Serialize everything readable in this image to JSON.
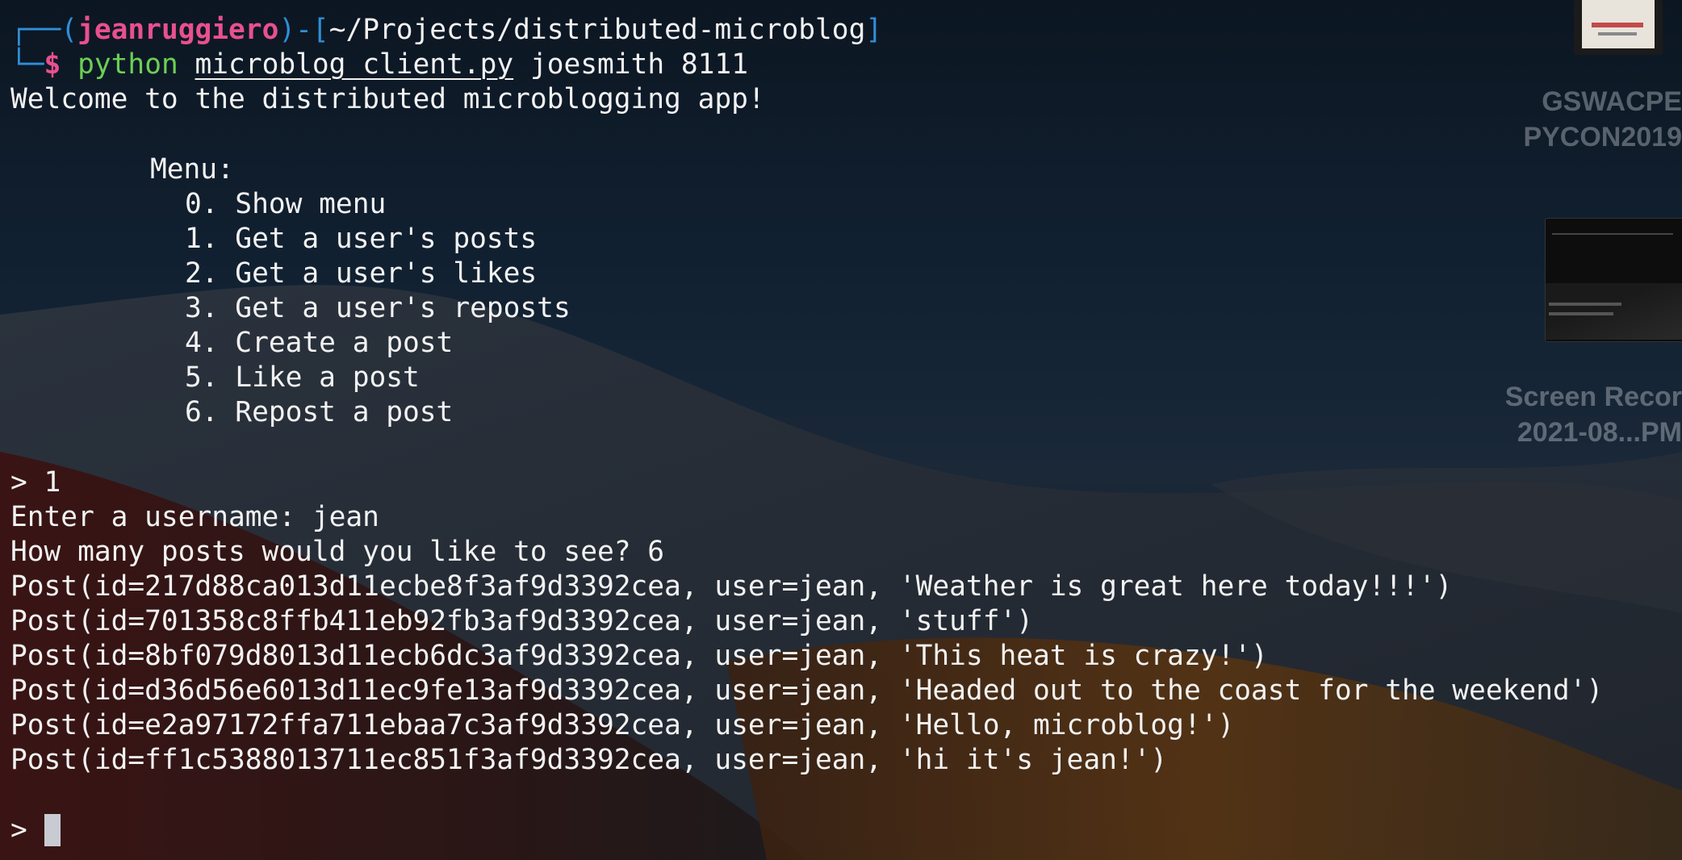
{
  "prompt": {
    "corner_top": "┌──",
    "open_paren": "(",
    "user": "jeanruggiero",
    "close_paren": ")",
    "dash": "-",
    "open_bracket": "[",
    "path": "~/Projects/distributed-microblog",
    "close_bracket": "]",
    "corner_bottom": "└─",
    "dollar": "$",
    "command": "python",
    "script": "microblog_client.py",
    "args": "joesmith 8111"
  },
  "output": {
    "welcome": "Welcome to the distributed microblogging app!",
    "menu_title": "Menu:",
    "menu_items": [
      "0. Show menu",
      "1. Get a user's posts",
      "2. Get a user's likes",
      "3. Get a user's reposts",
      "4. Create a post",
      "5. Like a post",
      "6. Repost a post"
    ],
    "input_choice": "> 1",
    "username_prompt": "Enter a username: jean",
    "count_prompt": "How many posts would you like to see? 6",
    "posts": [
      "Post(id=217d88ca013d11ecbe8f3af9d3392cea, user=jean, 'Weather is great here today!!!')",
      "Post(id=701358c8ffb411eb92fb3af9d3392cea, user=jean, 'stuff')",
      "Post(id=8bf079d8013d11ecb6dc3af9d3392cea, user=jean, 'This heat is crazy!')",
      "Post(id=d36d56e6013d11ec9fe13af9d3392cea, user=jean, 'Headed out to the coast for the weekend')",
      "Post(id=e2a97172ffa711ebaa7c3af9d3392cea, user=jean, 'Hello, microblog!')",
      "Post(id=ff1c5388013711ec851f3af9d3392cea, user=jean, 'hi it's jean!')"
    ],
    "final_prompt": "> "
  },
  "desktop": {
    "item1_line1": "GSWACPE",
    "item1_line2": "PYCON2019",
    "item2_line1": "Screen Recor",
    "item2_line2": "2021-08...PM"
  },
  "colors": {
    "prompt_frame": "#2f8fd8",
    "user": "#e8508e",
    "command": "#6ccf54",
    "text": "#f2f2f2",
    "cursor": "#c8ccd2"
  }
}
